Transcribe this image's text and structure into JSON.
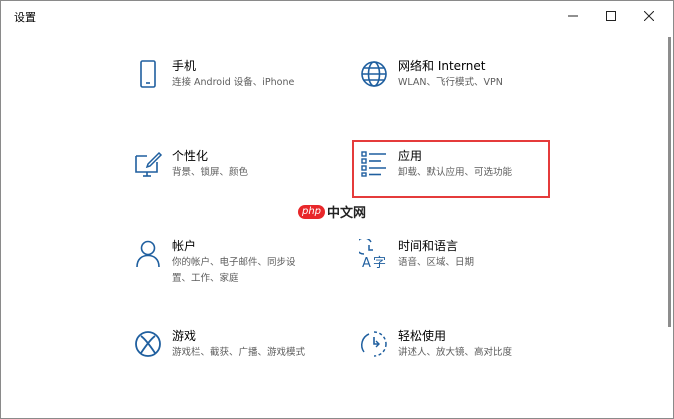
{
  "window": {
    "title": "设置",
    "minimize_glyph": "—",
    "maximize_glyph": "☐",
    "close_glyph": "✕"
  },
  "tiles": [
    {
      "key": "phone",
      "icon": "phone-icon",
      "name": "手机",
      "desc": [
        "连接 Android 设备、iPhone"
      ]
    },
    {
      "key": "network",
      "icon": "globe-icon",
      "name": "网络和 Internet",
      "desc": [
        "WLAN、飞行模式、VPN"
      ]
    },
    {
      "key": "personalization",
      "icon": "paintbrush-monitor-icon",
      "name": "个性化",
      "desc": [
        "背景、锁屏、颜色"
      ]
    },
    {
      "key": "apps",
      "icon": "apps-list-icon",
      "name": "应用",
      "desc": [
        "卸载、默认应用、可选功能"
      ]
    },
    {
      "key": "accounts",
      "icon": "person-icon",
      "name": "帐户",
      "desc": [
        "你的帐户、电子邮件、同步设",
        "置、工作、家庭"
      ]
    },
    {
      "key": "time-language",
      "icon": "time-language-icon",
      "name": "时间和语言",
      "desc": [
        "语音、区域、日期"
      ]
    },
    {
      "key": "gaming",
      "icon": "xbox-icon",
      "name": "游戏",
      "desc": [
        "游戏栏、截获、广播、游戏模式"
      ]
    },
    {
      "key": "ease-of-access",
      "icon": "ease-of-access-icon",
      "name": "轻松使用",
      "desc": [
        "讲述人、放大镜、高对比度"
      ]
    }
  ],
  "watermark": {
    "logo": "php",
    "text": "中文网"
  },
  "colors": {
    "highlight": "#e53b3b",
    "icon": "#1f5f9f",
    "watermark_logo": "#e8272a"
  }
}
